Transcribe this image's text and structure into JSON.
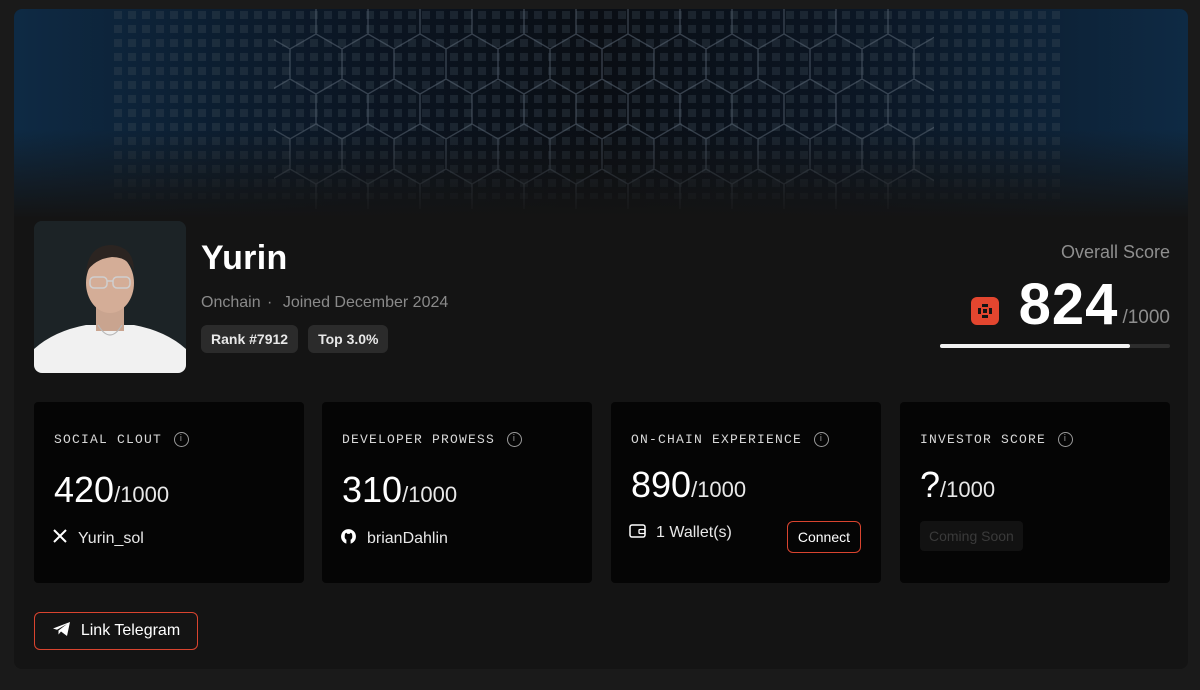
{
  "profile": {
    "name": "Yurin",
    "source": "Onchain",
    "separator": "·",
    "joined": "Joined December 2024",
    "rank_badge": "Rank #7912",
    "top_badge": "Top 3.0%"
  },
  "overall": {
    "label": "Overall Score",
    "value": "824",
    "max": "/1000",
    "progress_fraction": 0.824
  },
  "stats": [
    {
      "title": "SOCIAL CLOUT",
      "value": "420",
      "max": "/1000",
      "foot_icon": "x-logo-icon",
      "foot_text": "Yurin_sol"
    },
    {
      "title": "DEVELOPER PROWESS",
      "value": "310",
      "max": "/1000",
      "foot_icon": "github-icon",
      "foot_text": "brianDahlin"
    },
    {
      "title": "ON-CHAIN EXPERIENCE",
      "value": "890",
      "max": "/1000",
      "foot_icon": "wallet-icon",
      "foot_text": "1 Wallet(s)",
      "button": "Connect"
    },
    {
      "title": "INVESTOR SCORE",
      "value": "?",
      "max": "/1000",
      "button": "Coming Soon"
    }
  ],
  "telegram_button": "Link Telegram",
  "colors": {
    "accent": "#d9442f",
    "score_icon": "#e3462f",
    "card": "#050505",
    "background": "#141414"
  }
}
